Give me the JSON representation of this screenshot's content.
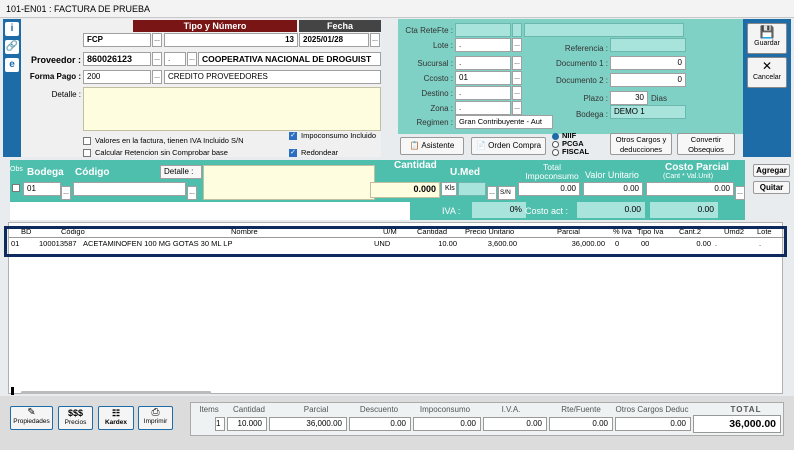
{
  "window_title": "101-EN01 : FACTURA DE PRUEBA",
  "header": {
    "tipo_numero_label": "Tipo y Número",
    "fecha_label": "Fecha",
    "tipo": "FCP",
    "numero": "13",
    "fecha": "2025/01/28",
    "proveedor_label": "Proveedor :",
    "proveedor_nit": "860026123",
    "proveedor_suc": ".",
    "proveedor_nombre": "COOPERATIVA NACIONAL DE DROGUIST",
    "forma_pago_label": "Forma Pago :",
    "forma_pago_code": "200",
    "forma_pago_desc": "CREDITO PROVEEDORES",
    "detalle_label": "Detalle :",
    "detalle": ""
  },
  "checks": {
    "iva_incluido": "Valores en la factura, tienen  IVA Incluido S/N",
    "calc_retencion": "Calcular Retencion sin Comprobar base",
    "impoconsumo": "Impoconsumo Incluido",
    "redondear": "Redondear"
  },
  "right_panel": {
    "cta_retefte_label": "Cta ReteFte :",
    "lote_label": "Lote :",
    "lote": ".",
    "sucursal_label": "Sucursal :",
    "sucursal": ".",
    "ccosto_label": "Ccosto :",
    "ccosto": "01",
    "destino_label": "Destino :",
    "destino": ".",
    "zona_label": "Zona :",
    "zona": ".",
    "regimen_label": "Regimen :",
    "regimen": "Gran Contribuyente - Aut",
    "referencia_label": "Referencia :",
    "doc1_label": "Documento 1 :",
    "doc1": "0",
    "doc2_label": "Documento 2 :",
    "doc2": "0",
    "plazo_label": "Plazo :",
    "plazo": "30",
    "plazo_unit": "Dias",
    "bodega_label": "Bodega :",
    "bodega": "DEMO 1"
  },
  "actions": {
    "asistente": "Asistente",
    "orden_compra": "Orden Compra",
    "niif": "NIIF",
    "pcga": "PCGA",
    "fiscal": "FISCAL",
    "otros_cargos": "Otros Cargos y deducciones",
    "convertir": "Convertir Obsequios",
    "guardar": "Guardar",
    "cancelar": "Cancelar",
    "agregar": "Agregar",
    "quitar": "Quitar"
  },
  "entry": {
    "obs_label": "Obs",
    "bodega_label": "Bodega",
    "codigo_label": "Código",
    "detalle_label": "Detalle :",
    "cantidad_label": "Cantidad",
    "umed_label": "U.Med",
    "total_impo_label": "Total Impoconsumo",
    "valor_unit_label": "Valor Unitario",
    "costo_parcial_label": "Costo Parcial",
    "costo_parcial_sub": "(Cant * Val.Unit)",
    "bodega": "01",
    "cantidad": "0.000",
    "umed": "Kls",
    "sn": "S/N",
    "total_impo": "0.00",
    "valor_unit": "0.00",
    "costo_parcial": "0.00",
    "iva_label": "IVA :",
    "iva_pct": "0%",
    "costo_act_label": "Costo act :",
    "costo_act": "0.00",
    "costo_act2": "0.00"
  },
  "grid": {
    "columns": [
      "BD",
      "Código",
      "Nombre",
      "U/M",
      "Cantidad",
      "Precio Unitario",
      "Parcial",
      "% Iva",
      "Tipo Iva",
      "Cant.2",
      "Umd2",
      "Lote"
    ],
    "rows": [
      [
        "01",
        "100013587",
        "ACETAMINOFEN 100 MG GOTAS 30 ML LP",
        "UND",
        "10.00",
        "3,600.00",
        "36,000.00",
        "0",
        "00",
        "0.00",
        ".",
        "."
      ]
    ]
  },
  "toolbar": {
    "propiedades": "Propiedades",
    "precios_icon": "$$$",
    "precios": "Precios",
    "kardex": "Kardex",
    "imprimir": "Imprimir"
  },
  "totals": {
    "items_label": "Items",
    "cantidad_label": "Cantidad",
    "parcial_label": "Parcial",
    "descuento_label": "Descuento",
    "impoconsumo_label": "Impoconsumo",
    "iva_label": "I.V.A.",
    "rte_label": "Rte/Fuente",
    "otros_label": "Otros Cargos Deduc",
    "total_label": "TOTAL",
    "items": "1",
    "cantidad": "10.000",
    "parcial": "36,000.00",
    "descuento": "0.00",
    "impoconsumo": "0.00",
    "iva": "0.00",
    "rte": "0.00",
    "otros": "0.00",
    "total": "36,000.00"
  }
}
